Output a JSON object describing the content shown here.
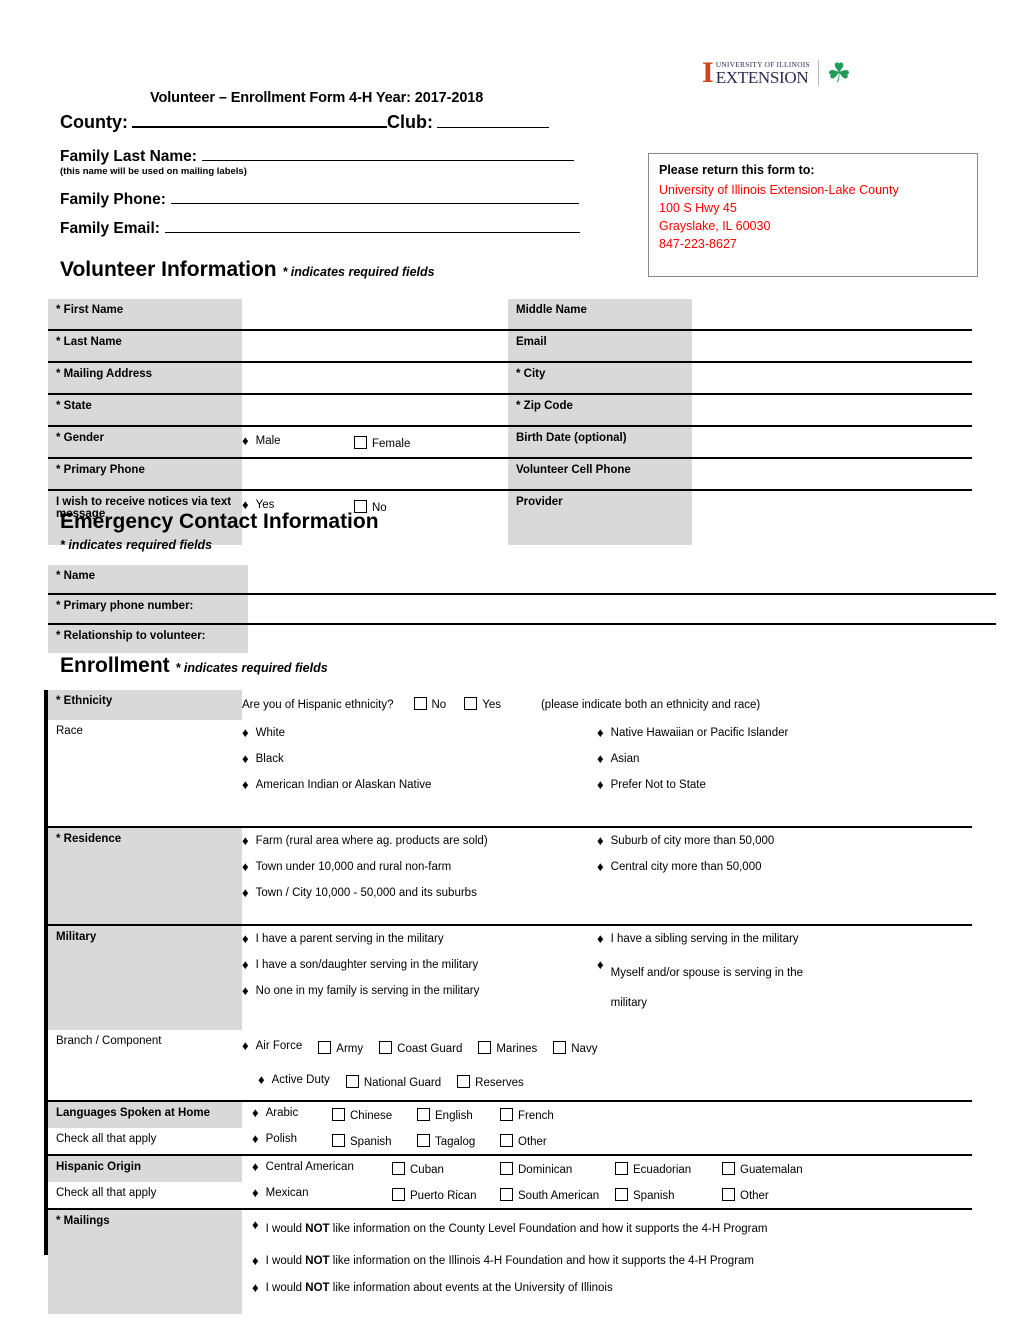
{
  "header": {
    "logo": {
      "block_i": "I",
      "line1": "UNIVERSITY OF ILLINOIS",
      "line2": "EXTENSION",
      "clover_icon": "four-leaf-clover-icon",
      "clover_glyph": "☘"
    },
    "title": "Volunteer – Enrollment Form  4-H Year: 2017-2018",
    "county_label": "County:",
    "club_label": "Club:",
    "family_last_name_label": "Family Last Name:",
    "family_last_name_note": "(this name will be used on mailing labels)",
    "family_phone_label": "Family Phone:",
    "family_email_label": "Family Email:"
  },
  "return_box": {
    "title": "Please return this form to:",
    "lines": [
      "University of Illinois Extension-Lake County",
      "100 S Hwy 45",
      "Grayslake, IL 60030",
      "847-223-8627"
    ],
    "color": "#ff0000"
  },
  "sections": {
    "volunteer": {
      "heading": "Volunteer Information",
      "note": "* indicates required fields"
    },
    "emergency": {
      "heading": "Emergency Contact Information",
      "note": "* indicates required fields"
    },
    "enrollment": {
      "heading": "Enrollment",
      "note": "* indicates required fields"
    }
  },
  "volunteer_table": {
    "rows": [
      {
        "left_label": "* First Name",
        "left_value": "",
        "right_label": "Middle Name",
        "right_value": ""
      },
      {
        "left_label": "* Last Name",
        "left_value": "",
        "right_label": "Email",
        "right_value": ""
      },
      {
        "left_label": "* Mailing Address",
        "left_value": "",
        "right_label": "* City",
        "right_value": ""
      },
      {
        "left_label": "* State",
        "left_value": "",
        "right_label": "* Zip Code",
        "right_value": ""
      },
      {
        "left_label": "* Gender",
        "left_value": "",
        "right_label": "Birth Date (optional)",
        "right_value": ""
      },
      {
        "left_label": "* Primary Phone",
        "left_value": "",
        "right_label": "Volunteer Cell Phone",
        "right_value": ""
      },
      {
        "left_label": "I wish to receive notices via text message",
        "left_value": "",
        "right_label": "Provider",
        "right_value": ""
      }
    ],
    "gender_options": [
      {
        "label": "Male",
        "marker": "diamond"
      },
      {
        "label": "Female",
        "marker": "checkbox"
      }
    ],
    "text_notice_options": [
      {
        "label": "Yes",
        "marker": "diamond"
      },
      {
        "label": "No",
        "marker": "checkbox"
      }
    ]
  },
  "emergency_table": {
    "rows": [
      {
        "label": "* Name",
        "value": ""
      },
      {
        "label": "* Primary phone number:",
        "value": ""
      },
      {
        "label": "* Relationship to volunteer:",
        "value": ""
      }
    ]
  },
  "enrollment": {
    "ethnicity": {
      "label": "* Ethnicity",
      "question": "Are you of Hispanic ethnicity?",
      "options": [
        {
          "label": "No",
          "marker": "checkbox"
        },
        {
          "label": "Yes",
          "marker": "checkbox"
        }
      ],
      "hint": "(please indicate both an ethnicity and race)"
    },
    "race": {
      "label": "Race",
      "col1": [
        {
          "label": "White",
          "marker": "diamond"
        },
        {
          "label": "Black",
          "marker": "diamond"
        },
        {
          "label": "American Indian or Alaskan Native",
          "marker": "diamond"
        }
      ],
      "col2": [
        {
          "label": "Native Hawaiian or Pacific Islander",
          "marker": "diamond"
        },
        {
          "label": "Asian",
          "marker": "diamond"
        },
        {
          "label": "Prefer Not to State",
          "marker": "diamond"
        }
      ]
    },
    "residence": {
      "label": "* Residence",
      "col1": [
        {
          "label": "Farm (rural area where ag. products are sold)",
          "marker": "diamond"
        },
        {
          "label": "Town under 10,000 and rural non-farm",
          "marker": "diamond"
        },
        {
          "label": "Town / City 10,000 - 50,000 and its suburbs",
          "marker": "diamond"
        }
      ],
      "col2": [
        {
          "label": "Suburb of city more than 50,000",
          "marker": "diamond"
        },
        {
          "label": "Central city more than 50,000",
          "marker": "diamond"
        }
      ]
    },
    "military": {
      "label": "Military",
      "col1": [
        {
          "label": "I have a parent serving in the military",
          "marker": "diamond"
        },
        {
          "label": "I have a son/daughter serving in the military",
          "marker": "diamond"
        },
        {
          "label": "No one in my family is serving in the military",
          "marker": "diamond"
        }
      ],
      "col2": [
        {
          "label": "I have a sibling serving in the military",
          "marker": "diamond"
        },
        {
          "label": "Myself and/or spouse is serving in the military",
          "marker": "diamond"
        }
      ]
    },
    "branch": {
      "label": "Branch / Component",
      "row1": [
        {
          "label": "Air Force",
          "marker": "diamond"
        },
        {
          "label": "Army",
          "marker": "checkbox"
        },
        {
          "label": "Coast Guard",
          "marker": "checkbox"
        },
        {
          "label": "Marines",
          "marker": "checkbox"
        },
        {
          "label": "Navy",
          "marker": "checkbox"
        }
      ],
      "row2": [
        {
          "label": "Active Duty",
          "marker": "diamond"
        },
        {
          "label": "National Guard",
          "marker": "checkbox"
        },
        {
          "label": "Reserves",
          "marker": "checkbox"
        }
      ]
    },
    "languages": {
      "label": "Languages Spoken at Home",
      "sublabel": "Check all that apply",
      "row1": [
        {
          "label": "Arabic",
          "marker": "diamond"
        },
        {
          "label": "Chinese",
          "marker": "checkbox"
        },
        {
          "label": "English",
          "marker": "checkbox"
        },
        {
          "label": "French",
          "marker": "checkbox"
        }
      ],
      "row2": [
        {
          "label": "Polish",
          "marker": "diamond"
        },
        {
          "label": "Spanish",
          "marker": "checkbox"
        },
        {
          "label": "Tagalog",
          "marker": "checkbox"
        },
        {
          "label": "Other",
          "marker": "checkbox"
        }
      ]
    },
    "hispanic_origin": {
      "label": "Hispanic Origin",
      "sublabel": "Check all that apply",
      "row1": [
        {
          "label": "Central American",
          "marker": "diamond"
        },
        {
          "label": "Cuban",
          "marker": "checkbox"
        },
        {
          "label": "Dominican",
          "marker": "checkbox"
        },
        {
          "label": "Ecuadorian",
          "marker": "checkbox"
        },
        {
          "label": "Guatemalan",
          "marker": "checkbox"
        }
      ],
      "row2": [
        {
          "label": "Mexican",
          "marker": "diamond"
        },
        {
          "label": "Puerto Rican",
          "marker": "checkbox"
        },
        {
          "label": "South American",
          "marker": "checkbox"
        },
        {
          "label": "Spanish",
          "marker": "checkbox"
        },
        {
          "label": "Other",
          "marker": "checkbox"
        }
      ]
    },
    "mailings": {
      "label": "* Mailings",
      "items": [
        {
          "marker": "diamond",
          "pre": "I would ",
          "bold": "NOT",
          "post": " like information on the County Level Foundation and how it supports the 4-H Program"
        },
        {
          "marker": "diamond",
          "pre": "I would ",
          "bold": "NOT",
          "post": " like information on the Illinois 4-H Foundation and how it supports the 4-H Program"
        },
        {
          "marker": "diamond",
          "pre": "I would ",
          "bold": "NOT",
          "post": " like information about events at the University of Illinois"
        }
      ]
    }
  },
  "glyphs": {
    "diamond": "♦"
  }
}
